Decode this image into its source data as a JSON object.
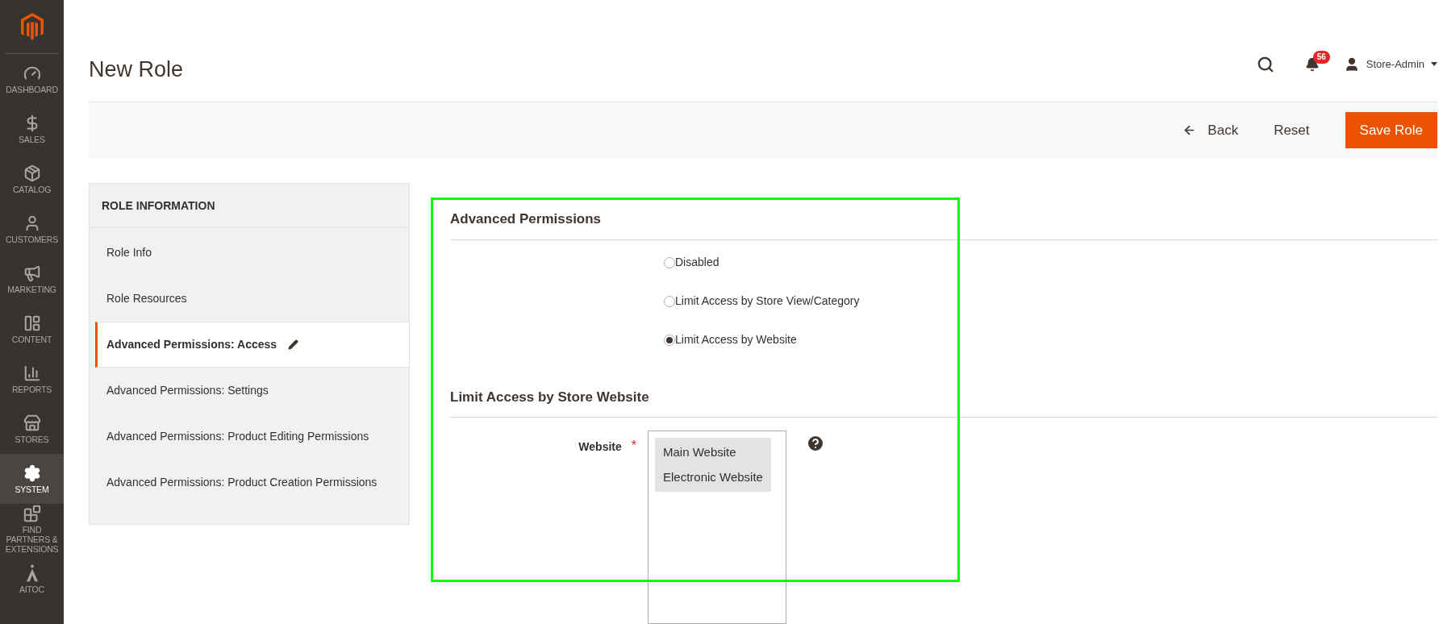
{
  "sidebar": {
    "items": [
      {
        "label": "DASHBOARD",
        "selected": false
      },
      {
        "label": "SALES",
        "selected": false
      },
      {
        "label": "CATALOG",
        "selected": false
      },
      {
        "label": "CUSTOMERS",
        "selected": false
      },
      {
        "label": "MARKETING",
        "selected": false
      },
      {
        "label": "CONTENT",
        "selected": false
      },
      {
        "label": "REPORTS",
        "selected": false
      },
      {
        "label": "STORES",
        "selected": false
      },
      {
        "label": "SYSTEM",
        "selected": true
      },
      {
        "label": "FIND PARTNERS & EXTENSIONS",
        "selected": false
      },
      {
        "label": "AITOC",
        "selected": false
      }
    ]
  },
  "header": {
    "title": "New Role",
    "notifications": "56",
    "user": "Store-Admin"
  },
  "actions": {
    "back": "Back",
    "reset": "Reset",
    "save": "Save Role"
  },
  "tabs": {
    "title": "ROLE INFORMATION",
    "items": [
      {
        "label": "Role Info",
        "selected": false,
        "edited": false
      },
      {
        "label": "Role Resources",
        "selected": false,
        "edited": false
      },
      {
        "label": "Advanced Permissions: Access",
        "selected": true,
        "edited": true
      },
      {
        "label": "Advanced Permissions: Settings",
        "selected": false,
        "edited": false
      },
      {
        "label": "Advanced Permissions: Product Editing Permissions",
        "selected": false,
        "edited": false
      },
      {
        "label": "Advanced Permissions: Product Creation Permissions",
        "selected": false,
        "edited": false
      }
    ]
  },
  "form": {
    "section_1": {
      "title": "Advanced Permissions",
      "radios": [
        {
          "label": "Disabled",
          "selected": false
        },
        {
          "label": "Limit Access by Store View/Category",
          "selected": false
        },
        {
          "label": "Limit Access by Website",
          "selected": true
        }
      ]
    },
    "section_2": {
      "title": "Limit Access by Store Website",
      "field": {
        "label": "Website",
        "required_mark": "*",
        "options": [
          {
            "label": "Main Website",
            "selected": true
          },
          {
            "label": "Electronic Website",
            "selected": true
          }
        ]
      }
    }
  }
}
